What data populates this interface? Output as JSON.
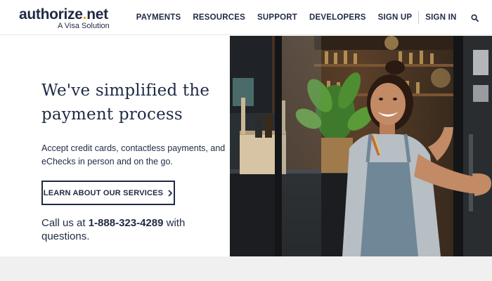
{
  "brand": {
    "logo_main_before_dot": "authorize",
    "logo_dot": ".",
    "logo_main_after_dot": "net",
    "logo_sub": "A Visa Solution",
    "accent_color": "#f0a500",
    "text_color": "#1f2a44"
  },
  "nav": {
    "items": [
      {
        "label": "PAYMENTS"
      },
      {
        "label": "RESOURCES"
      },
      {
        "label": "SUPPORT"
      },
      {
        "label": "DEVELOPERS"
      },
      {
        "label": "SIGN UP"
      },
      {
        "label": "SIGN IN"
      }
    ],
    "search_icon": "search-icon"
  },
  "hero": {
    "title_line1": "We've simplified the",
    "title_line2": "payment process",
    "description": "Accept credit cards, contactless payments, and eChecks in person and on the go.",
    "cta_label": "LEARN ABOUT OUR SERVICES",
    "cta_icon": "chevron-right-icon",
    "call_prefix": "Call us at ",
    "call_phone": "1-888-323-4289",
    "call_suffix": " with questions."
  },
  "image": {
    "subject": "smiling woman in apron at shop door"
  }
}
